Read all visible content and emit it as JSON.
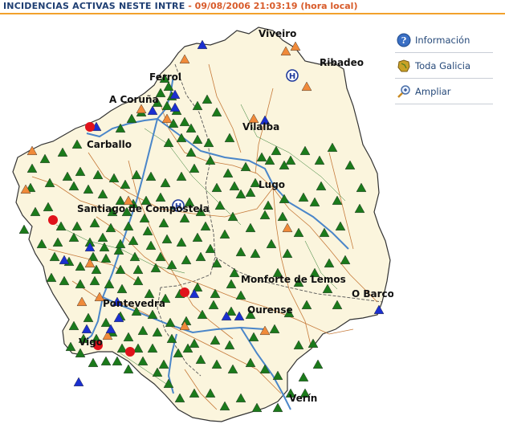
{
  "header": {
    "title": "INCIDENCIAS ACTIVAS NESTE INTRE",
    "separator": " - ",
    "timestamp": "09/08/2006 21:03:19 (hora local)"
  },
  "side_menu": {
    "items": [
      {
        "label": "Información",
        "icon": "info-icon"
      },
      {
        "label": "Toda Galicia",
        "icon": "galicia-map-icon"
      },
      {
        "label": "Ampliar",
        "icon": "zoom-in-icon"
      }
    ]
  },
  "map": {
    "towns": [
      "Viveiro",
      "Ribadeo",
      "Ferrol",
      "A Coruña",
      "Vilalba",
      "Carballo",
      "Lugo",
      "Santiago de Compostela",
      "Monforte de Lemos",
      "O Barco",
      "Ourense",
      "Vigo",
      "Verín",
      "Pontevedra"
    ],
    "markers": {
      "fire_active": {
        "symbol": "green-triangle",
        "color": "#1b7a1b"
      },
      "fire_controlled": {
        "symbol": "orange-triangle",
        "color": "#f08a3a"
      },
      "fire_new": {
        "symbol": "blue-triangle",
        "color": "#1a2fd0"
      },
      "alert": {
        "symbol": "red-circle",
        "color": "#e0121b"
      },
      "hospital": {
        "symbol": "hospital-icon",
        "color": "#1f3a9c"
      }
    }
  }
}
